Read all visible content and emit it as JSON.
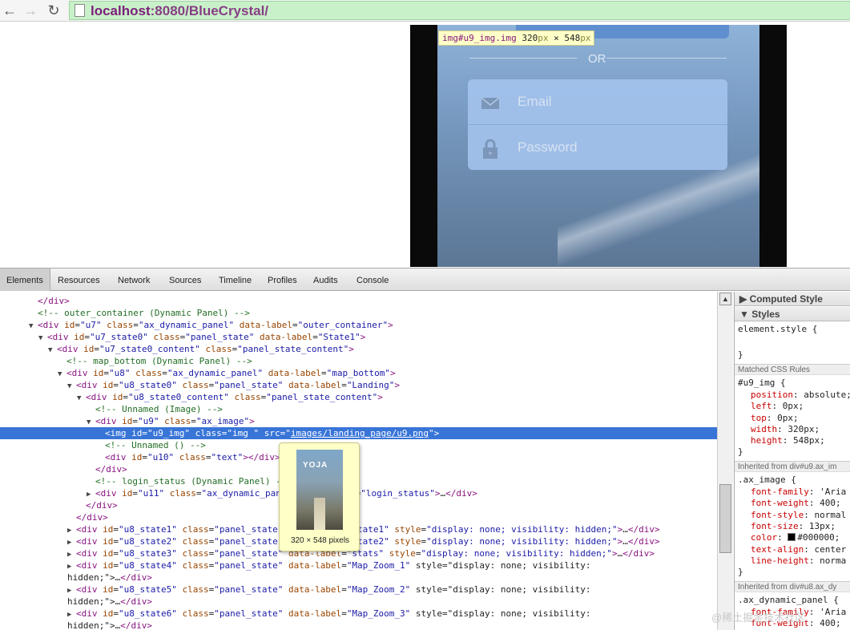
{
  "browser": {
    "url_host": "localhost",
    "url_rest": ":8080/BlueCrystal/"
  },
  "page": {
    "or_text": "OR",
    "email_placeholder": "Email",
    "password_placeholder": "Password",
    "inspect_tooltip": {
      "selector": "img#u9_img.img",
      "w": "320",
      "h": "548",
      "unit": "px",
      "times": "×"
    }
  },
  "devtools": {
    "tabs": [
      "Elements",
      "Resources",
      "Network",
      "Sources",
      "Timeline",
      "Profiles",
      "Audits",
      "Console"
    ],
    "active_tab": "Elements",
    "dom_lines": [
      {
        "i": 0,
        "tri": "",
        "html": "</div>",
        "kind": "close"
      },
      {
        "i": 0,
        "tri": "",
        "html": "<!-- outer_container (Dynamic Panel) -->",
        "kind": "comment"
      },
      {
        "i": 0,
        "tri": "▼",
        "html": "<div id=\"u7\" class=\"ax_dynamic_panel\" data-label=\"outer_container\">"
      },
      {
        "i": 1,
        "tri": "▼",
        "html": "<div id=\"u7_state0\" class=\"panel_state\" data-label=\"State1\">"
      },
      {
        "i": 2,
        "tri": "▼",
        "html": "<div id=\"u7_state0_content\" class=\"panel_state_content\">"
      },
      {
        "i": 3,
        "tri": "",
        "html": "<!-- map_bottom (Dynamic Panel) -->",
        "kind": "comment"
      },
      {
        "i": 3,
        "tri": "▼",
        "html": "<div id=\"u8\" class=\"ax_dynamic_panel\" data-label=\"map_bottom\">"
      },
      {
        "i": 4,
        "tri": "▼",
        "html": "<div id=\"u8_state0\" class=\"panel_state\" data-label=\"Landing\">"
      },
      {
        "i": 5,
        "tri": "▼",
        "html": "<div id=\"u8_state0_content\" class=\"panel_state_content\">"
      },
      {
        "i": 6,
        "tri": "",
        "html": "<!-- Unnamed (Image) -->",
        "kind": "comment"
      },
      {
        "i": 6,
        "tri": "▼",
        "html": "<div id=\"u9\" class=\"ax_image\">"
      },
      {
        "i": 7,
        "tri": "",
        "html": "<img id=\"u9_img\" class=\"img \" src=\"images/landing_page/u9.png\">",
        "selected": true
      },
      {
        "i": 7,
        "tri": "",
        "html": "<!-- Unnamed () -->",
        "kind": "comment"
      },
      {
        "i": 7,
        "tri": "",
        "html": "<div id=\"u10\" class=\"text\"></div>"
      },
      {
        "i": 6,
        "tri": "",
        "html": "</div>",
        "kind": "close"
      },
      {
        "i": 6,
        "tri": "",
        "html": "<!-- login_status (Dynamic Panel) -->",
        "kind": "comment"
      },
      {
        "i": 6,
        "tri": "▶",
        "html": "<div id=\"u11\" class=\"ax_dynamic_panel\" data-label=\"login_status\">…</div>"
      },
      {
        "i": 5,
        "tri": "",
        "html": "</div>",
        "kind": "close"
      },
      {
        "i": 4,
        "tri": "",
        "html": "</div>",
        "kind": "close"
      },
      {
        "i": 4,
        "tri": "▶",
        "html": "<div id=\"u8_state1\" class=\"panel_state\" data-label=\"State1\" style=\"display: none; visibility: hidden;\">…</div>"
      },
      {
        "i": 4,
        "tri": "▶",
        "html": "<div id=\"u8_state2\" class=\"panel_state\" data-label=\"State2\" style=\"display: none; visibility: hidden;\">…</div>"
      },
      {
        "i": 4,
        "tri": "▶",
        "html": "<div id=\"u8_state3\" class=\"panel_state\" data-label=\"stats\" style=\"display: none; visibility: hidden;\">…</div>"
      },
      {
        "i": 4,
        "tri": "▶",
        "html": "<div id=\"u8_state4\" class=\"panel_state\" data-label=\"Map_Zoom_1\" style=\"display: none; visibility:"
      },
      {
        "i": 4,
        "tri": "",
        "html": "hidden;\">…</div>",
        "wrap": true
      },
      {
        "i": 4,
        "tri": "▶",
        "html": "<div id=\"u8_state5\" class=\"panel_state\" data-label=\"Map_Zoom_2\" style=\"display: none; visibility:"
      },
      {
        "i": 4,
        "tri": "",
        "html": "hidden;\">…</div>",
        "wrap": true
      },
      {
        "i": 4,
        "tri": "▶",
        "html": "<div id=\"u8_state6\" class=\"panel_state\" data-label=\"Map_Zoom_3\" style=\"display: none; visibility:"
      },
      {
        "i": 4,
        "tri": "",
        "html": "hidden;\">…</div>",
        "wrap": true
      }
    ],
    "side": {
      "computed_style": "Computed Style",
      "styles": "Styles",
      "element_style_open": "element.style {",
      "close_brace": "}",
      "matched_rules": "Matched CSS Rules",
      "rule1_selector": "#u9_img {",
      "rule1_props": [
        {
          "n": "position",
          "v": "absolute;"
        },
        {
          "n": "left",
          "v": "0px;"
        },
        {
          "n": "top",
          "v": "0px;"
        },
        {
          "n": "width",
          "v": "320px;"
        },
        {
          "n": "height",
          "v": "548px;"
        }
      ],
      "inherited1": "Inherited from div#u9.ax_im",
      "rule2_selector": ".ax_image {",
      "rule2_props": [
        {
          "n": "font-family",
          "v": "'Aria"
        },
        {
          "n": "font-weight",
          "v": "400;"
        },
        {
          "n": "font-style",
          "v": "normal"
        },
        {
          "n": "font-size",
          "v": "13px;"
        },
        {
          "n": "color",
          "v": "#000000;",
          "swatch": true
        },
        {
          "n": "text-align",
          "v": "center"
        },
        {
          "n": "line-height",
          "v": "norma"
        }
      ],
      "inherited2": "Inherited from div#u8.ax_dy",
      "rule3_selector": ".ax_dynamic_panel {",
      "rule3_props": [
        {
          "n": "font-family",
          "v": "'Aria"
        },
        {
          "n": "font-weight",
          "v": "400;"
        }
      ]
    },
    "popover": {
      "logo": "YOJA",
      "caption": "320 × 548 pixels"
    }
  },
  "watermark": "@稀土掘金技术社区"
}
